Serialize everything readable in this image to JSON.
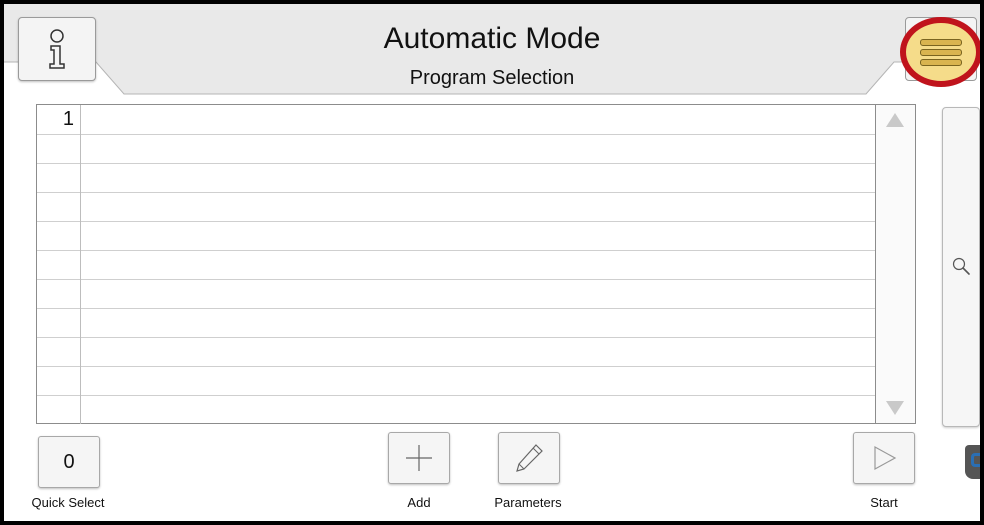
{
  "header": {
    "title": "Automatic Mode",
    "subtitle": "Program Selection"
  },
  "program_list": {
    "rows": [
      "1",
      "",
      "",
      "",
      "",
      "",
      "",
      "",
      "",
      "",
      ""
    ]
  },
  "toolbar": {
    "quick_select_value": "0",
    "quick_select_label": "Quick Select",
    "add_label": "Add",
    "parameters_label": "Parameters",
    "start_label": "Start"
  },
  "icons": {
    "info": "info-icon",
    "menu": "menu-icon",
    "search": "search-icon",
    "add": "plus-icon",
    "parameters": "pencil-icon",
    "start": "play-icon"
  },
  "colors": {
    "highlight_ring": "#c0131c",
    "highlight_fill": "#f5dc8a"
  }
}
